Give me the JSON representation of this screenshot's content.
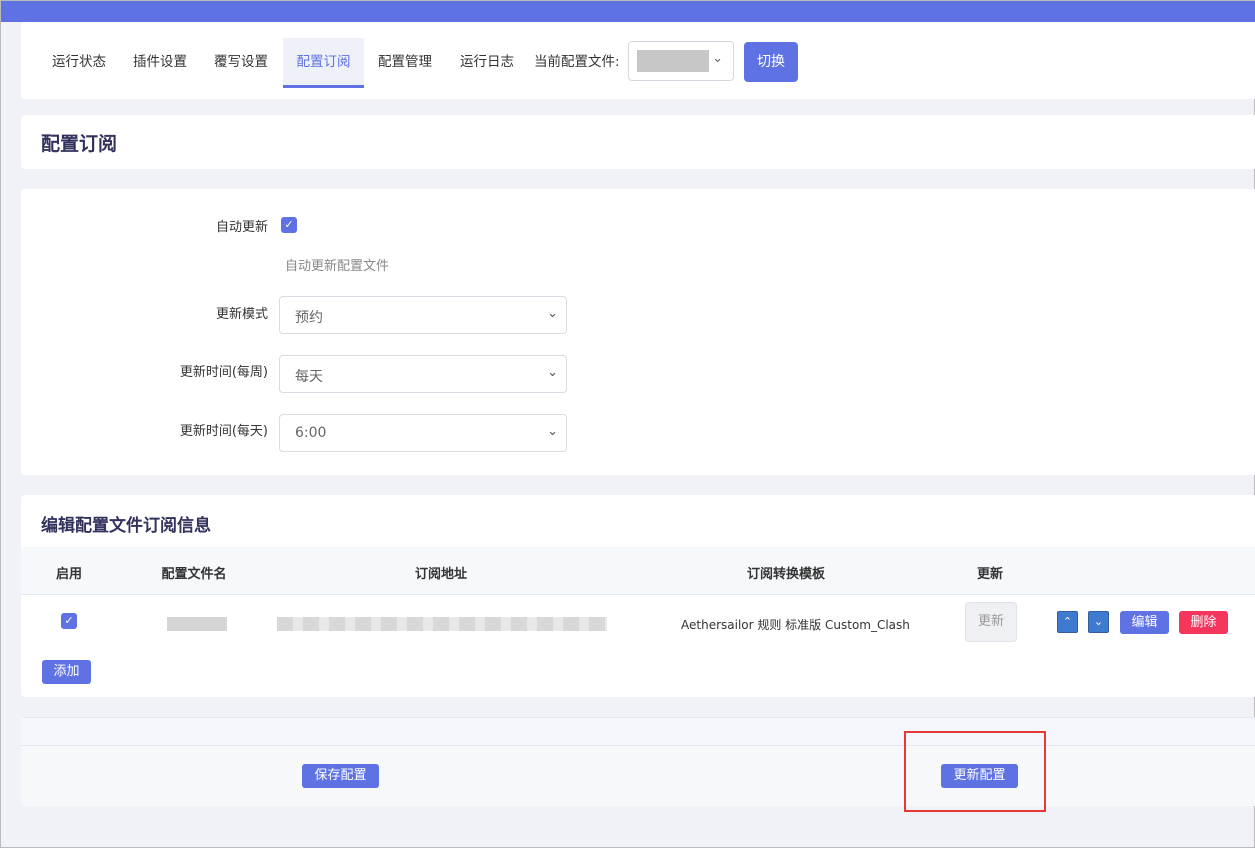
{
  "tabs": [
    {
      "label": "运行状态"
    },
    {
      "label": "插件设置"
    },
    {
      "label": "覆写设置"
    },
    {
      "label": "配置订阅"
    },
    {
      "label": "配置管理"
    },
    {
      "label": "运行日志"
    }
  ],
  "current_config": {
    "label": "当前配置文件:",
    "switch_label": "切换"
  },
  "page_title": "配置订阅",
  "form": {
    "auto_update": {
      "label": "自动更新",
      "checked": true,
      "help": "自动更新配置文件"
    },
    "update_mode": {
      "label": "更新模式",
      "value": "预约"
    },
    "update_weekly": {
      "label": "更新时间(每周)",
      "value": "每天"
    },
    "update_daily": {
      "label": "更新时间(每天)",
      "value": "6:00"
    }
  },
  "subscription": {
    "title": "编辑配置文件订阅信息",
    "columns": [
      "启用",
      "配置文件名",
      "订阅地址",
      "订阅转换模板",
      "更新"
    ],
    "rows": [
      {
        "enabled": true,
        "template": "Aethersailor 规则 标准版 Custom_Clash",
        "update_label": "更新"
      }
    ],
    "edit_label": "编辑",
    "delete_label": "删除",
    "add_label": "添加"
  },
  "footer": {
    "save_label": "保存配置",
    "update_label": "更新配置"
  },
  "colors": {
    "primary": "#5e72e4",
    "danger": "#f5365c",
    "highlight": "#e53935"
  }
}
